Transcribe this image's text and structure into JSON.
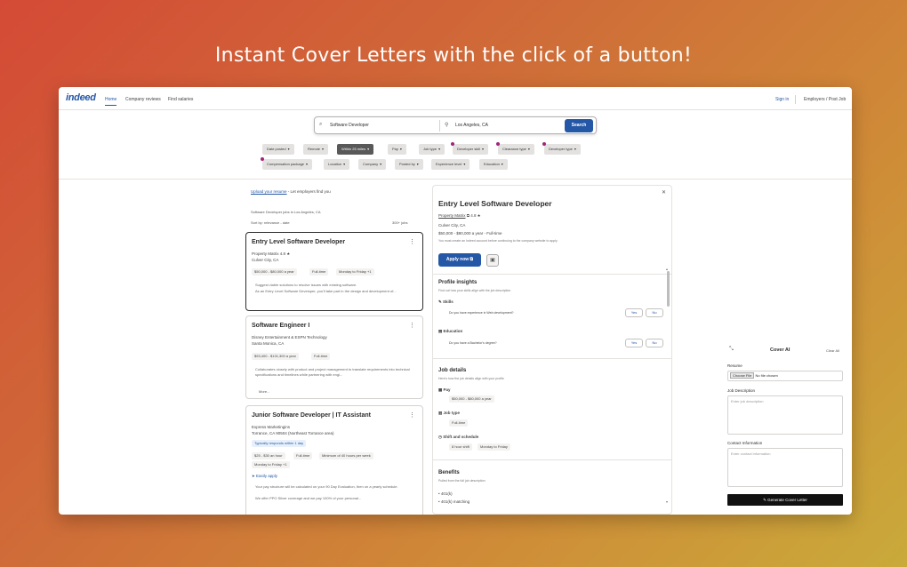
{
  "headline": "Instant Cover Letters with the click of a button!",
  "nav": {
    "logo": "indeed",
    "links": [
      "Home",
      "Company reviews",
      "Find salaries"
    ],
    "sign_in": "Sign in",
    "employers": "Employers / Post Job"
  },
  "search": {
    "what": "Software Developer",
    "where": "Los Angeles, CA",
    "button": "Search"
  },
  "filters_row1": [
    "Date posted",
    "Remote",
    "Within 25 miles",
    "Pay",
    "Job type",
    "Developer skill",
    "Clearance type",
    "Developer type"
  ],
  "filters_row2": [
    "Compensation package",
    "Location",
    "Company",
    "Posted by",
    "Experience level",
    "Education"
  ],
  "left": {
    "upload_link": "Upload your resume",
    "upload_rest": " - Let employers find you",
    "breadcrumb": "Software Developer jobs in Los Angeles, CA",
    "sort": "Sort by: relevance - date",
    "count": "300+ jobs"
  },
  "cards": [
    {
      "title": "Entry Level Software Developer",
      "company": "Property Matrix  4.8 ★",
      "location": "Culver City, CA",
      "chips": [
        "$50,000 - $80,000 a year",
        "Full-time",
        "Monday to Friday +1"
      ],
      "bullets": [
        "Suggest viable solutions to resolve issues with existing software.",
        "As an Entry Level Software Developer, you'll take part in the design and development of..."
      ]
    },
    {
      "title": "Software Engineer I",
      "company": "Disney Entertainment & ESPN Technology",
      "location": "Santa Monica, CA",
      "chips": [
        "$93,400 - $131,300 a year",
        "Full-time"
      ],
      "bullets": [
        "Collaborates closely with product and project management to translate requirements into technical specifications and timelines while partnering with engi..."
      ],
      "more": "More..."
    },
    {
      "title": "Junior Software Developer | IT Assistant",
      "company": "Express Marketingins",
      "location": "Torrance, CA 90504 (Northeast Torrance area)",
      "badge": "Typically responds within 1 day",
      "chips": [
        "$25 - $30 an hour",
        "Full-time",
        "Minimum of 40 hours per week",
        "Monday to Friday +1"
      ],
      "easily": "Easily apply",
      "bullets": [
        "Your pay structure will be calculated on your 90 Day Evaluation, then on a yearly schedule.",
        "We offer PPO Silver coverage and we pay 100% of your personal..."
      ]
    }
  ],
  "detail": {
    "title": "Entry Level Software Developer",
    "company": "Property Matrix",
    "rating": "4.8",
    "location": "Culver City, CA",
    "salary": "$50,000 - $80,000 a year  -  Full-time",
    "note": "You must create an Indeed account before continuing to the company website to apply",
    "apply": "Apply now",
    "profile_title": "Profile insights",
    "profile_sub": "Find out how your skills align with the job description",
    "skills_label": "Skills",
    "skills_q": "Do you have experience in Web development?",
    "education_label": "Education",
    "education_q": "Do you have a Bachelor's degree?",
    "yes": "Yes",
    "no": "No",
    "jobdetails_title": "Job details",
    "jobdetails_sub": "Here's how the job details align with your profile",
    "pay_label": "Pay",
    "pay_value": "$50,000 - $80,000 a year",
    "jobtype_label": "Job type",
    "jobtype_value": "Full-time",
    "shift_label": "Shift and schedule",
    "shift_values": [
      "8 hour shift",
      "Monday to Friday"
    ],
    "benefits_title": "Benefits",
    "benefits_sub": "Pulled from the full job description",
    "benefits": [
      "401(k)",
      "401(k) matching"
    ]
  },
  "coverai": {
    "title": "Cover AI",
    "clear": "Clear All",
    "resume_label": "Resume",
    "choose": "Choose File",
    "no_file": "No file chosen",
    "jd_label": "Job Description",
    "jd_placeholder": "Enter job description",
    "contact_label": "Contact Information",
    "contact_placeholder": "Enter contact information",
    "generate": "Generate Cover Letter"
  }
}
